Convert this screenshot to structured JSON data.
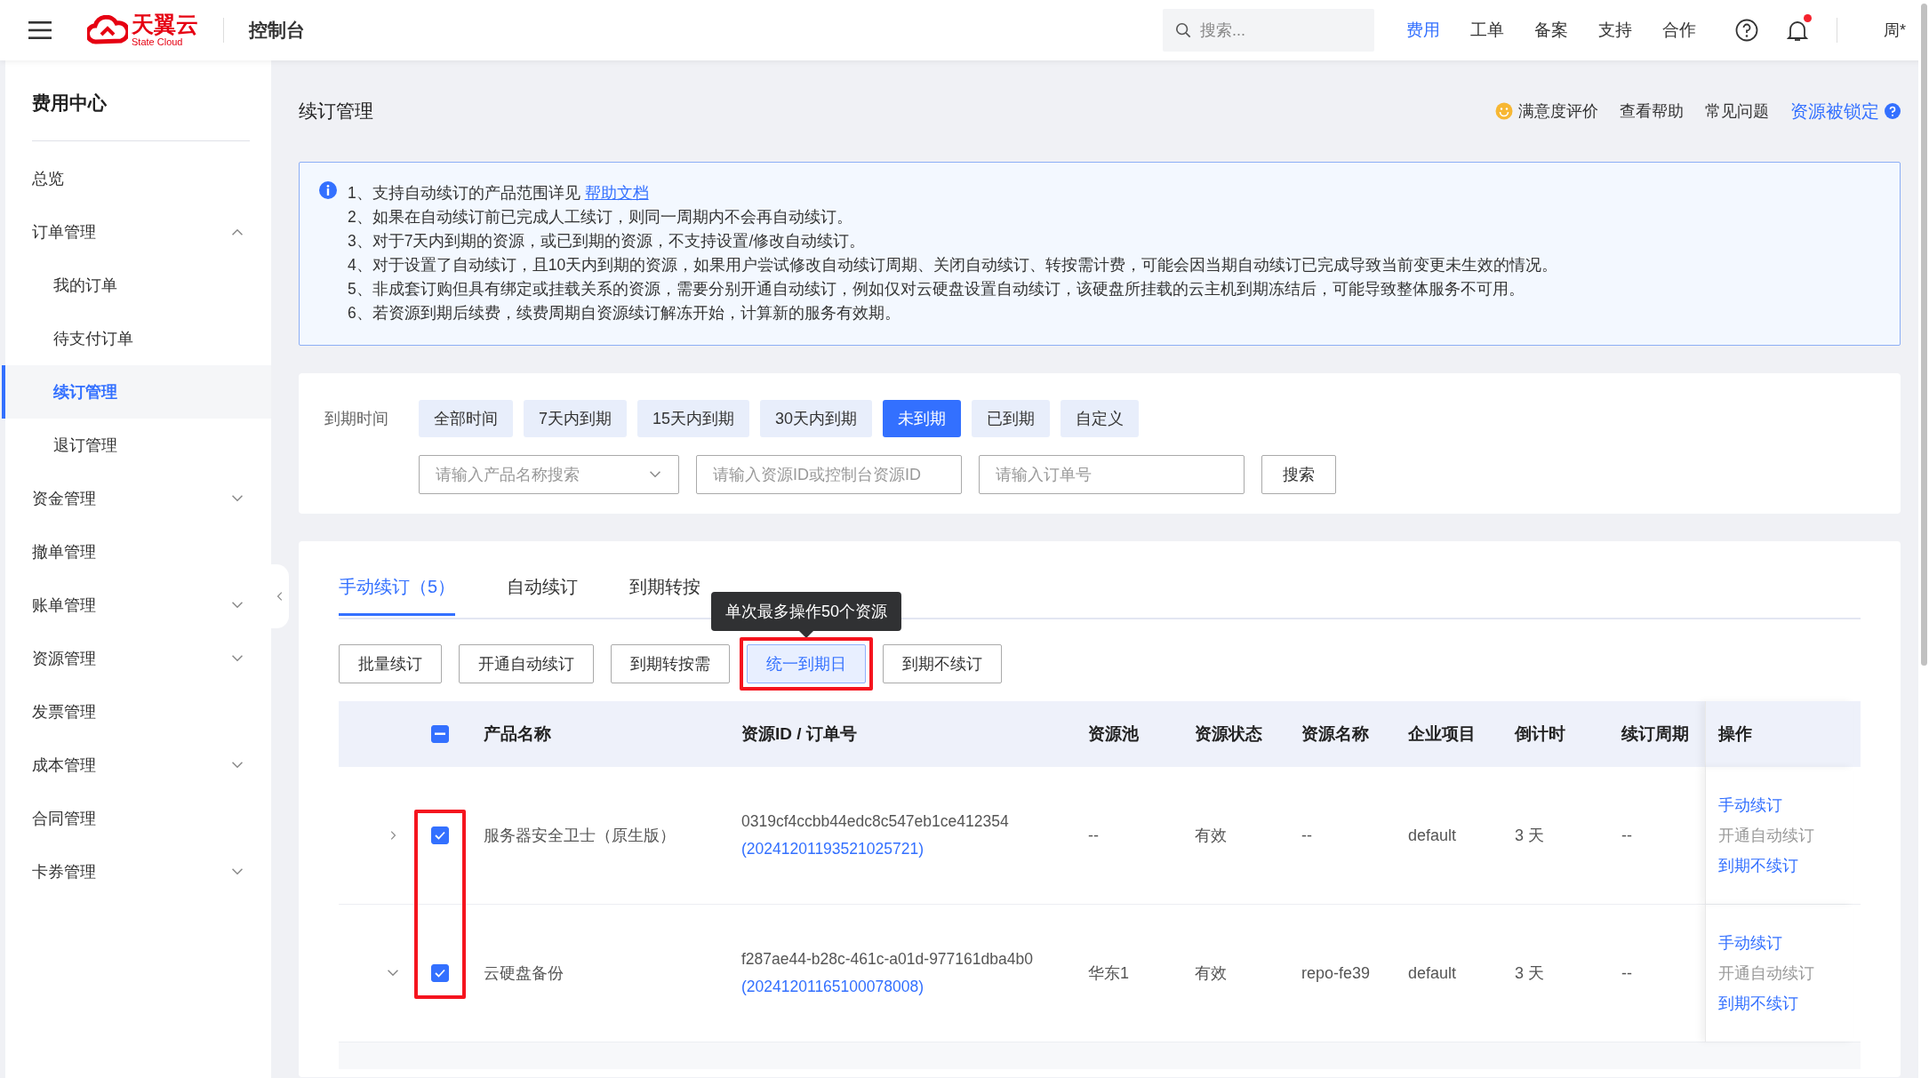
{
  "topbar": {
    "logo": {
      "name": "天翼云",
      "tagline": "State Cloud"
    },
    "title": "控制台",
    "search": {
      "placeholder": "搜索..."
    },
    "nav": [
      {
        "label": "费用",
        "selected": true
      },
      {
        "label": "工单",
        "selected": false
      },
      {
        "label": "备案",
        "selected": false
      },
      {
        "label": "支持",
        "selected": false
      },
      {
        "label": "合作",
        "selected": false
      }
    ],
    "notifications": {
      "unread": true
    },
    "user": "周*"
  },
  "sidebar": {
    "title": "费用中心",
    "items": [
      {
        "label": "总览",
        "selected": false
      },
      {
        "label": "订单管理",
        "selected": false,
        "expanded": true,
        "children": [
          {
            "label": "我的订单",
            "selected": false
          },
          {
            "label": "待支付订单",
            "selected": false
          },
          {
            "label": "续订管理",
            "selected": true
          },
          {
            "label": "退订管理",
            "selected": false
          }
        ]
      },
      {
        "label": "资金管理",
        "selected": false,
        "expanded": false
      },
      {
        "label": "撤单管理",
        "selected": false
      },
      {
        "label": "账单管理",
        "selected": false,
        "expanded": false
      },
      {
        "label": "资源管理",
        "selected": false,
        "expanded": false
      },
      {
        "label": "发票管理",
        "selected": false
      },
      {
        "label": "成本管理",
        "selected": false,
        "expanded": false
      },
      {
        "label": "合同管理",
        "selected": false
      },
      {
        "label": "卡券管理",
        "selected": false,
        "expanded": false
      }
    ]
  },
  "page": {
    "title": "续订管理",
    "links": [
      {
        "label": "满意度评价",
        "kind": "rating"
      },
      {
        "label": "查看帮助",
        "kind": "plain"
      },
      {
        "label": "常见问题",
        "kind": "plain"
      },
      {
        "label": "资源被锁定",
        "kind": "help"
      }
    ]
  },
  "notice": {
    "lines": [
      {
        "text": "1、支持自动续订的产品范围详见 ",
        "link": "帮助文档"
      },
      {
        "text": "2、如果在自动续订前已完成人工续订，则同一周期内不会再自动续订。"
      },
      {
        "text": "3、对于7天内到期的资源，或已到期的资源，不支持设置/修改自动续订。"
      },
      {
        "text": "4、对于设置了自动续订，且10天内到期的资源，如果用户尝试修改自动续订周期、关闭自动续订、转按需计费，可能会因当期自动续订已完成导致当前变更未生效的情况。"
      },
      {
        "text": "5、非成套订购但具有绑定或挂载关系的资源，需要分别开通自动续订，例如仅对云硬盘设置自动续订，该硬盘所挂载的云主机到期冻结后，可能导致整体服务不可用。"
      },
      {
        "text": "6、若资源到期后续费，续费周期自资源续订解冻开始，计算新的服务有效期。"
      }
    ]
  },
  "filter": {
    "label": "到期时间",
    "options": [
      {
        "label": "全部时间",
        "selected": false
      },
      {
        "label": "7天内到期",
        "selected": false
      },
      {
        "label": "15天内到期",
        "selected": false
      },
      {
        "label": "30天内到期",
        "selected": false
      },
      {
        "label": "未到期",
        "selected": true
      },
      {
        "label": "已到期",
        "selected": false
      },
      {
        "label": "自定义",
        "selected": false
      }
    ],
    "product_select": {
      "placeholder": "请输入产品名称搜索"
    },
    "resource_field": {
      "placeholder": "请输入资源ID或控制台资源ID"
    },
    "order_field": {
      "placeholder": "请输入订单号"
    },
    "search_button": "搜索"
  },
  "tabs": [
    {
      "label": "手动续订（5）",
      "selected": true
    },
    {
      "label": "自动续订",
      "selected": false
    },
    {
      "label": "到期转按",
      "selected": false
    }
  ],
  "actions": [
    {
      "label": "批量续订",
      "selected": false
    },
    {
      "label": "开通自动续订",
      "selected": false
    },
    {
      "label": "到期转按需",
      "selected": false
    },
    {
      "label": "统一到期日",
      "selected": true,
      "highlighted": true,
      "tooltip": "单次最多操作50个资源"
    },
    {
      "label": "到期不续订",
      "selected": false
    }
  ],
  "table": {
    "select_all": {
      "indeterminate": true
    },
    "checkboxes_highlighted": true,
    "columns": [
      "产品名称",
      "资源ID / 订单号",
      "资源池",
      "资源状态",
      "资源名称",
      "企业项目",
      "倒计时",
      "续订周期",
      "操作"
    ],
    "rows": [
      {
        "expanded": false,
        "checked": true,
        "product": "服务器安全卫士（原生版）",
        "resource_id": "0319cf4ccbb44edc8c547eb1ce412354",
        "order_no": "(20241201193521025721)",
        "pool": "--",
        "status": "有效",
        "name": "--",
        "project": "default",
        "countdown": "3 天",
        "period": "--",
        "operations": [
          {
            "label": "手动续订",
            "disabled": false
          },
          {
            "label": "开通自动续订",
            "disabled": true
          },
          {
            "label": "到期不续订",
            "disabled": false
          }
        ]
      },
      {
        "expanded": true,
        "checked": true,
        "product": "云硬盘备份",
        "resource_id": "f287ae44-b28c-461c-a01d-977161dba4b0",
        "order_no": "(20241201165100078008)",
        "pool": "华东1",
        "status": "有效",
        "name": "repo-fe39",
        "project": "default",
        "countdown": "3 天",
        "period": "--",
        "operations": [
          {
            "label": "手动续订",
            "disabled": false
          },
          {
            "label": "开通自动续订",
            "disabled": true
          },
          {
            "label": "到期不续订",
            "disabled": false
          }
        ]
      }
    ]
  }
}
